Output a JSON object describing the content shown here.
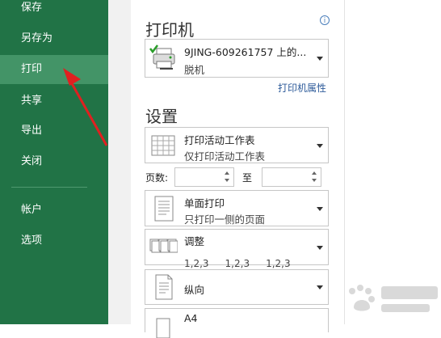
{
  "nav": {
    "items": [
      {
        "label": "保存"
      },
      {
        "label": "另存为"
      },
      {
        "label": "打印"
      },
      {
        "label": "共享"
      },
      {
        "label": "导出"
      },
      {
        "label": "关闭"
      },
      {
        "label": "帐户"
      },
      {
        "label": "选项"
      }
    ]
  },
  "printer_section": {
    "title": "打印机",
    "info_icon": "i",
    "printer_name": "9JING-609261757 上的...",
    "printer_status": "脱机",
    "properties_link": "打印机属性"
  },
  "settings_section": {
    "title": "设置",
    "print_what": {
      "main": "打印活动工作表",
      "sub": "仅打印活动工作表"
    },
    "pages_label": "页数:",
    "to_label": "至",
    "pages_from": "",
    "pages_to": "",
    "sides": {
      "main": "单面打印",
      "sub": "只打印一侧的页面"
    },
    "collate": {
      "main": "调整",
      "seq": [
        "1,2,3",
        "1,2,3",
        "1,2,3"
      ]
    },
    "orientation": {
      "main": "纵向"
    },
    "paper": {
      "main": "A4"
    }
  },
  "colors": {
    "sidebar": "#217346",
    "sidebar_active": "#439467",
    "accent_arrow": "#e02020",
    "link": "#2e5b9a"
  }
}
